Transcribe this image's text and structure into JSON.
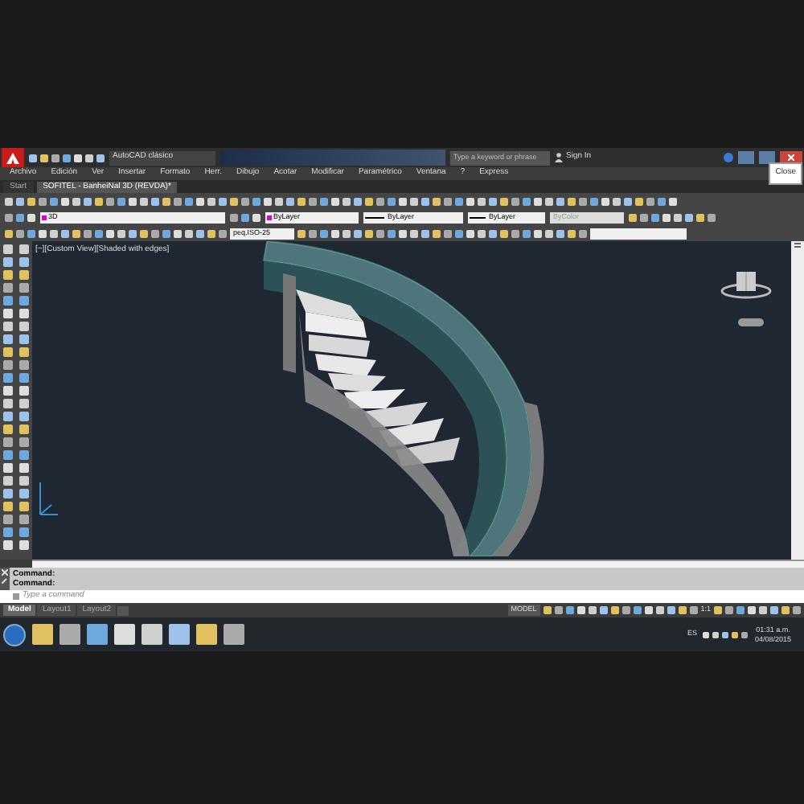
{
  "title_bar": {
    "workspace": "AutoCAD clásico",
    "search_placeholder": "Type a keyword or phrase",
    "sign_in": "Sign In"
  },
  "tooltip": "Close",
  "menu": [
    "Archivo",
    "Edición",
    "Ver",
    "Insertar",
    "Formato",
    "Herr.",
    "Dibujo",
    "Acotar",
    "Modificar",
    "Paramétrico",
    "Ventana",
    "?",
    "Express"
  ],
  "file_tabs": [
    {
      "label": "Start",
      "selected": false
    },
    {
      "label": "SOFITEL - BanheiNal 3D (REVDA)*",
      "selected": true
    }
  ],
  "properties": {
    "layer": "3D",
    "color_setting": "ByLayer",
    "linetype": "ByLayer",
    "lineweight": "ByLayer",
    "plot_style": "ByColor",
    "dim_style": "peq.ISO-25"
  },
  "viewport": {
    "label": "[−][Custom View][Shaded with edges]"
  },
  "command_history": [
    "Command:",
    "Command:"
  ],
  "command_placeholder": "Type a command",
  "layout_tabs": [
    {
      "label": "Model",
      "selected": true
    },
    {
      "label": "Layout1",
      "selected": false
    },
    {
      "label": "Layout2",
      "selected": false
    }
  ],
  "status": {
    "space": "MODEL",
    "scale": "1:1"
  },
  "taskbar": {
    "language": "ES",
    "time": "01:31 a.m.",
    "date": "04/08/2015"
  }
}
